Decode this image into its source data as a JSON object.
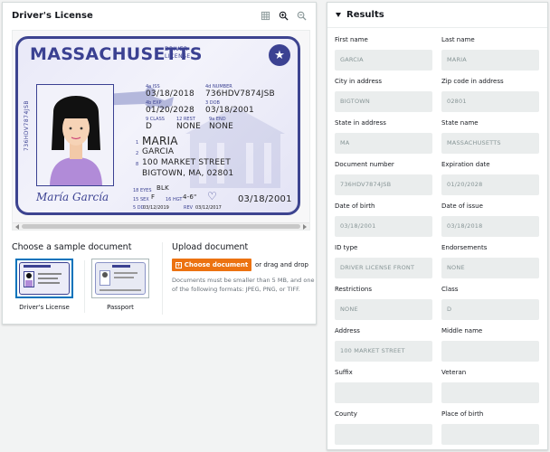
{
  "left_panel": {
    "title": "Driver's License",
    "tools": [
      "grid-icon",
      "zoom-in-icon",
      "zoom-out-icon"
    ]
  },
  "license": {
    "state": "MASSACHUSETTS",
    "doc_line1": "DRIVER",
    "doc_line2": "LICENSE",
    "side_number": "736HDV7874JSB",
    "iss_label": "4a ISS",
    "iss_value": "03/18/2018",
    "number_label": "4d NUMBER",
    "number_value": "736HDV7874JSB",
    "exp_label": "4b EXP",
    "exp_value": "01/20/2028",
    "dob_label": "3 DOB",
    "dob_value": "03/18/2001",
    "class_label": "9 CLASS",
    "class_value": "D",
    "rest_label": "12 REST",
    "rest_value": "NONE",
    "end_label": "9a END",
    "end_value": "NONE",
    "field1_no": "1",
    "last_name": "MARIA",
    "field2_no": "2",
    "first_name": "GARCIA",
    "field8_no": "8",
    "address1": "100 MARKET STREET",
    "address2": "BIGTOWN, MA, 02801",
    "eyes_label": "18 EYES",
    "eyes_value": "BLK",
    "sex_label": "15 SEX",
    "sex_value": "F",
    "hgt_label": "16 HGT",
    "hgt_value": "4-6\"",
    "dd_label": "5 DD",
    "dd_value": "03/12/2019",
    "rev_label": "REV",
    "rev_value": "03/12/2017",
    "bottom_date": "03/18/2001",
    "signature": "María García"
  },
  "samples": {
    "title": "Choose a sample document",
    "items": [
      {
        "label": "Driver's License",
        "selected": true
      },
      {
        "label": "Passport",
        "selected": false
      }
    ]
  },
  "upload": {
    "title": "Upload document",
    "button_label": "Choose document",
    "drag_text": "or drag and drop",
    "note": "Documents must be smaller than 5 MB, and one of the following formats: JPEG, PNG, or TIFF."
  },
  "results": {
    "title": "Results",
    "fields": [
      {
        "label": "First name",
        "value": "GARCIA"
      },
      {
        "label": "Last name",
        "value": "MARIA"
      },
      {
        "label": "City in address",
        "value": "BIGTOWN"
      },
      {
        "label": "Zip code in address",
        "value": "02801"
      },
      {
        "label": "State in address",
        "value": "MA"
      },
      {
        "label": "State name",
        "value": "MASSACHUSETTS"
      },
      {
        "label": "Document number",
        "value": "736HDV7874JSB"
      },
      {
        "label": "Expiration date",
        "value": "01/20/2028"
      },
      {
        "label": "Date of birth",
        "value": "03/18/2001"
      },
      {
        "label": "Date of issue",
        "value": "03/18/2018"
      },
      {
        "label": "ID type",
        "value": "DRIVER LICENSE FRONT"
      },
      {
        "label": "Endorsements",
        "value": "NONE"
      },
      {
        "label": "Restrictions",
        "value": "NONE"
      },
      {
        "label": "Class",
        "value": "D"
      },
      {
        "label": "Address",
        "value": "100 MARKET STREET"
      },
      {
        "label": "Middle name",
        "value": ""
      },
      {
        "label": "Suffix",
        "value": ""
      },
      {
        "label": "Veteran",
        "value": ""
      },
      {
        "label": "County",
        "value": ""
      },
      {
        "label": "Place of birth",
        "value": ""
      }
    ]
  },
  "colors": {
    "accent": "#ec7211",
    "card_blue": "#3b4192",
    "selected_border": "#0073bb"
  }
}
